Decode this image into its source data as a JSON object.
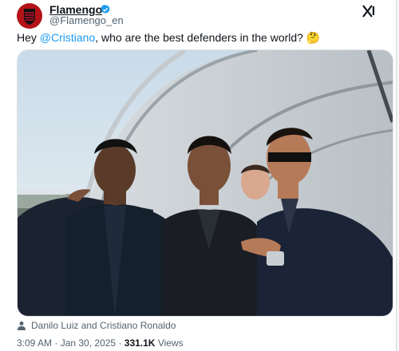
{
  "author": {
    "name": "Flamengo",
    "handle": "@Flamengo_en",
    "verified": true
  },
  "tweet": {
    "text_prefix": "Hey ",
    "mention": "@Cristiano",
    "text_suffix": ", who are the best defenders in the world? 🤔"
  },
  "media": {
    "tagged_people": "Danilo Luiz and Cristiano Ronaldo"
  },
  "meta": {
    "time": "3:09 AM",
    "separator": " · ",
    "date": "Jan 30, 2025",
    "views_count": "331.1K",
    "views_label": " Views"
  },
  "colors": {
    "link": "#1d9bf0",
    "verified": "#1d9bf0",
    "secondary_text": "#536471"
  },
  "icons": {
    "verified": "verified-badge-icon",
    "x_logo": "x-logo-icon",
    "person": "person-tag-icon"
  }
}
